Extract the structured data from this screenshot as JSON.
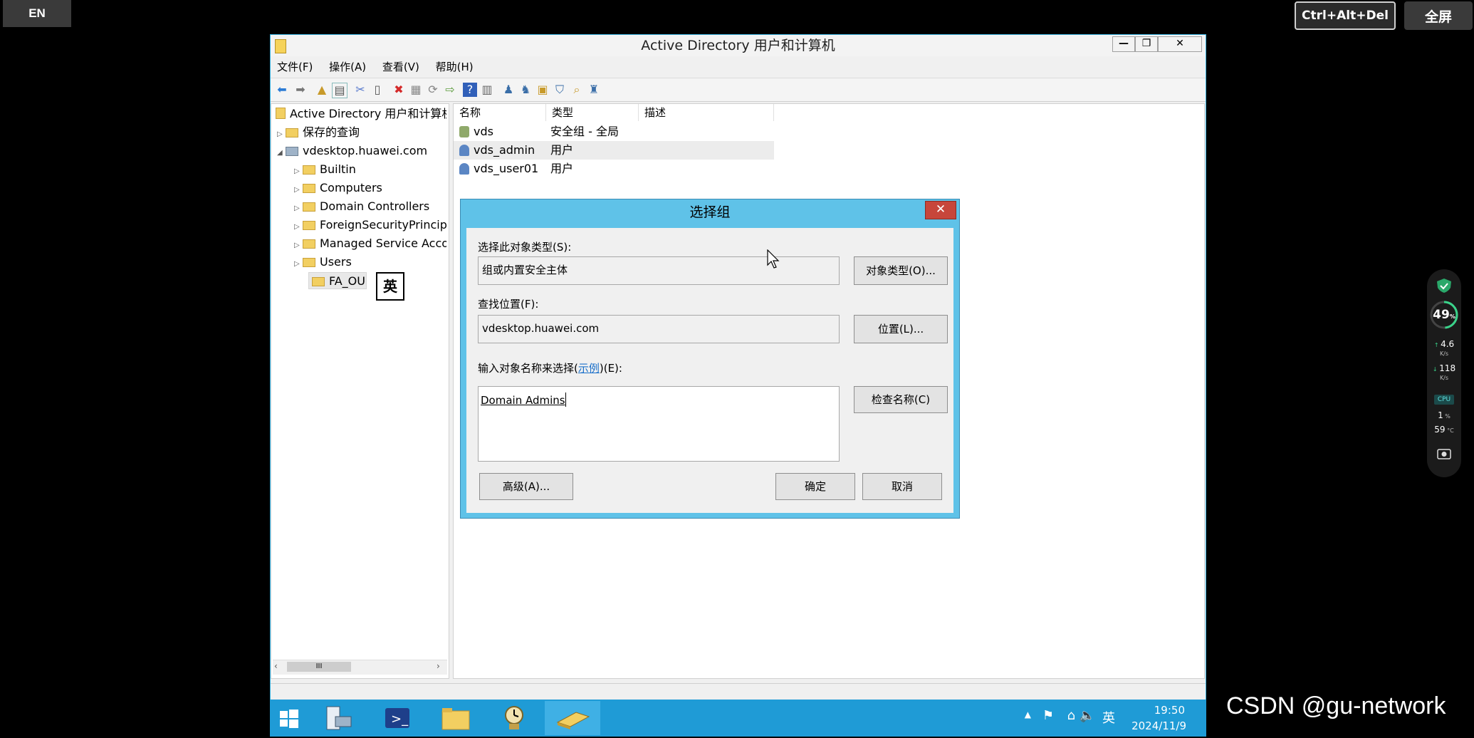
{
  "overlay": {
    "lang": "EN",
    "ctrl_alt_del": "Ctrl+Alt+Del",
    "fullscreen": "全屏"
  },
  "window": {
    "title": "Active Directory 用户和计算机",
    "controls": {
      "minimize": "—",
      "restore": "❐",
      "close": "✕"
    },
    "menu": [
      "文件(F)",
      "操作(A)",
      "查看(V)",
      "帮助(H)"
    ]
  },
  "tree": {
    "root": "Active Directory 用户和计算机",
    "saved_queries": "保存的查询",
    "domain": "vdesktop.huawei.com",
    "children": [
      "Builtin",
      "Computers",
      "Domain Controllers",
      "ForeignSecurityPrincipals",
      "Managed Service Accounts",
      "Users",
      "FA_OU"
    ]
  },
  "list": {
    "columns": [
      "名称",
      "类型",
      "描述"
    ],
    "rows": [
      {
        "name": "vds",
        "type": "安全组 - 全局"
      },
      {
        "name": "vds_admin",
        "type": "用户"
      },
      {
        "name": "vds_user01",
        "type": "用户"
      }
    ]
  },
  "ime_indicator": "英",
  "dialog": {
    "title": "选择组",
    "object_type_label": "选择此对象类型(S):",
    "object_type_value": "组或内置安全主体",
    "object_type_button": "对象类型(O)...",
    "location_label": "查找位置(F):",
    "location_value": "vdesktop.huawei.com",
    "location_button": "位置(L)...",
    "names_label_pre": "输入对象名称来选择(",
    "names_label_link": "示例",
    "names_label_post": ")(E):",
    "names_value": "Domain Admins",
    "check_names_button": "检查名称(C)",
    "advanced_button": "高级(A)...",
    "ok_button": "确定",
    "cancel_button": "取消"
  },
  "taskbar": {
    "time": "19:50",
    "date": "2024/11/9",
    "ime": "英"
  },
  "perf": {
    "score": "49",
    "score_unit": "%",
    "up": "4.6",
    "up_unit": "K/s",
    "down": "118",
    "down_unit": "K/s",
    "cpu_label": "CPU",
    "cpu": "1",
    "cpu_unit": "%",
    "temp": "59",
    "temp_unit": "°C"
  },
  "watermark": "CSDN @gu-network",
  "colors": {
    "accent": "#1f9bd6",
    "dialog_frame": "#5fc2e8",
    "close_red": "#c7463b"
  }
}
